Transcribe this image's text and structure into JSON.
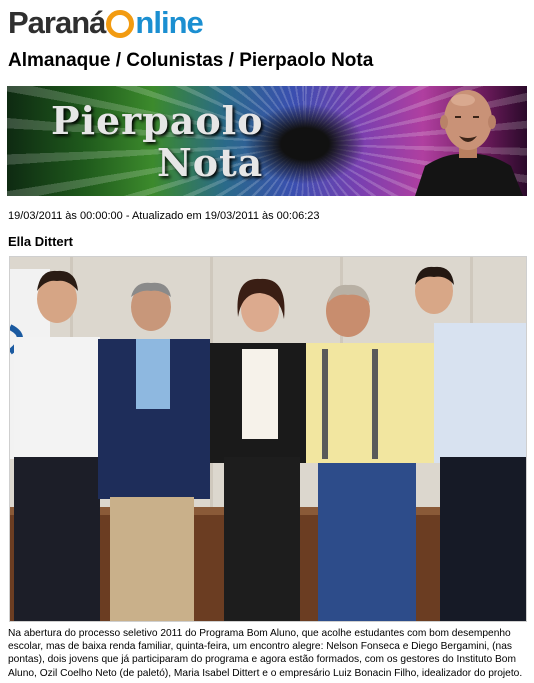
{
  "site": {
    "logo_part1": "Paraná",
    "logo_part2": "nline"
  },
  "breadcrumb": "Almanaque / Colunistas / Pierpaolo Nota",
  "banner": {
    "title_line1": "Pierpaolo",
    "title_line2": "Nota"
  },
  "article": {
    "meta": "19/03/2011 às 00:00:00 - Atualizado em 19/03/2011 às 00:06:23",
    "title": "Ella Dittert",
    "caption": "Na abertura do processo seletivo 2011 do Programa Bom Aluno, que acolhe estudantes com bom desempenho escolar, mas de baixa renda familiar, quinta-feira, um encontro alegre: Nelson Fonseca e Diego Bergamini, (nas pontas), dois jovens que já participaram do programa e agora estão formados, com os gestores do Instituto Bom Aluno, Ozil Coelho Neto (de paletó),  Maria Isabel Dittert e o empresário Luiz Bonacin Filho,  idealizador do projeto."
  },
  "colors": {
    "logo_dark": "#2f2f2f",
    "logo_orange": "#f29b11",
    "logo_blue": "#1b8fd1"
  }
}
